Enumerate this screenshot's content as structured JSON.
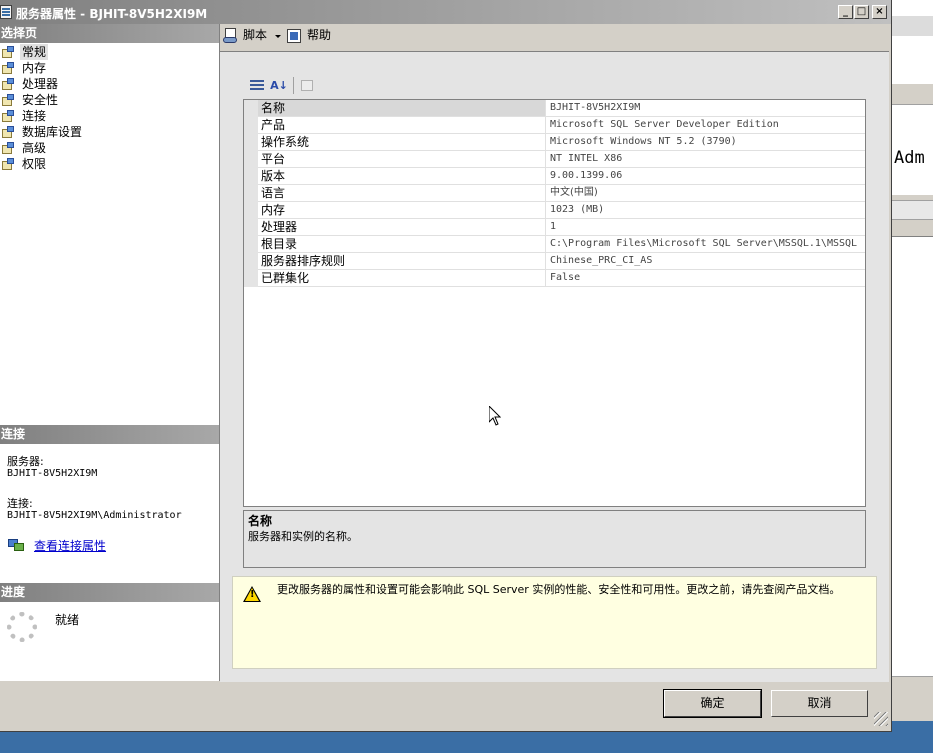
{
  "window": {
    "title": "服务器属性 - BJHIT-8V5H2XI9M"
  },
  "background_window": {
    "visible_text": "Adm"
  },
  "left": {
    "select_page_header": "选择页",
    "pages": [
      {
        "label": "常规",
        "selected": true
      },
      {
        "label": "内存",
        "selected": false
      },
      {
        "label": "处理器",
        "selected": false
      },
      {
        "label": "安全性",
        "selected": false
      },
      {
        "label": "连接",
        "selected": false
      },
      {
        "label": "数据库设置",
        "selected": false
      },
      {
        "label": "高级",
        "selected": false
      },
      {
        "label": "权限",
        "selected": false
      }
    ],
    "connection_header": "连接",
    "server_label": "服务器:",
    "server_value": "BJHIT-8V5H2XI9M",
    "connection_label": "连接:",
    "connection_value": "BJHIT-8V5H2XI9M\\Administrator",
    "view_connection_link": "查看连接属性",
    "progress_header": "进度",
    "progress_status": "就绪"
  },
  "toolbar": {
    "script_label": "脚本",
    "help_label": "帮助"
  },
  "properties": {
    "rows": [
      {
        "name": "名称",
        "value": "BJHIT-8V5H2XI9M"
      },
      {
        "name": "产品",
        "value": "Microsoft SQL Server Developer Edition"
      },
      {
        "name": "操作系统",
        "value": "Microsoft Windows NT 5.2 (3790)"
      },
      {
        "name": "平台",
        "value": "NT INTEL X86"
      },
      {
        "name": "版本",
        "value": "9.00.1399.06"
      },
      {
        "name": "语言",
        "value": "中文(中国)"
      },
      {
        "name": "内存",
        "value": "1023 (MB)"
      },
      {
        "name": "处理器",
        "value": "1"
      },
      {
        "name": "根目录",
        "value": "C:\\Program Files\\Microsoft SQL Server\\MSSQL.1\\MSSQL"
      },
      {
        "name": "服务器排序规则",
        "value": "Chinese_PRC_CI_AS"
      },
      {
        "name": "已群集化",
        "value": "False"
      }
    ]
  },
  "description": {
    "title": "名称",
    "text": "服务器和实例的名称。"
  },
  "warning": {
    "text": "更改服务器的属性和设置可能会影响此 SQL Server 实例的性能、安全性和可用性。更改之前，请先查阅产品文档。"
  },
  "buttons": {
    "ok": "确定",
    "cancel": "取消"
  },
  "colors": {
    "dialog_bg": "#d4d0c8",
    "desktop": "#3a6ea5",
    "warning_bg": "#ffffe1",
    "link": "#0000cc"
  }
}
